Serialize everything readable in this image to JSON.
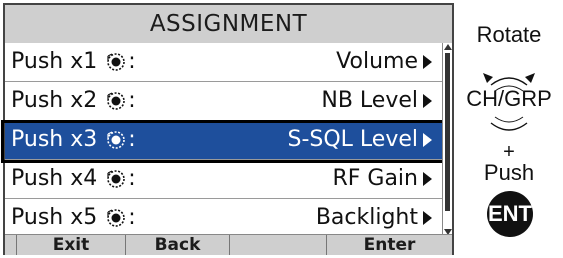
{
  "screen": {
    "title": "ASSIGNMENT",
    "items": [
      {
        "label": "Push x1",
        "value": "Volume",
        "selected": false
      },
      {
        "label": "Push x2",
        "value": "NB Level",
        "selected": false
      },
      {
        "label": "Push x3",
        "value": "S-SQL Level",
        "selected": true
      },
      {
        "label": "Push x4",
        "value": "RF Gain",
        "selected": false
      },
      {
        "label": "Push x5",
        "value": "Backlight",
        "selected": false
      }
    ],
    "colon": ":",
    "softkeys": [
      "",
      "Exit",
      "Back",
      "",
      "Enter"
    ]
  },
  "instruction": {
    "rotate": "Rotate",
    "dial_label": "CH/GRP",
    "plus": "+",
    "push": "Push",
    "key": "ENT"
  },
  "icons": {
    "row_icon": "knob-icon",
    "row_arrow": "right-triangle-icon",
    "dial": "rotary-dial-icon"
  },
  "colors": {
    "selected_row": "#1e4f9c",
    "title_bar": "#cfcfcf",
    "frame": "#000000"
  }
}
